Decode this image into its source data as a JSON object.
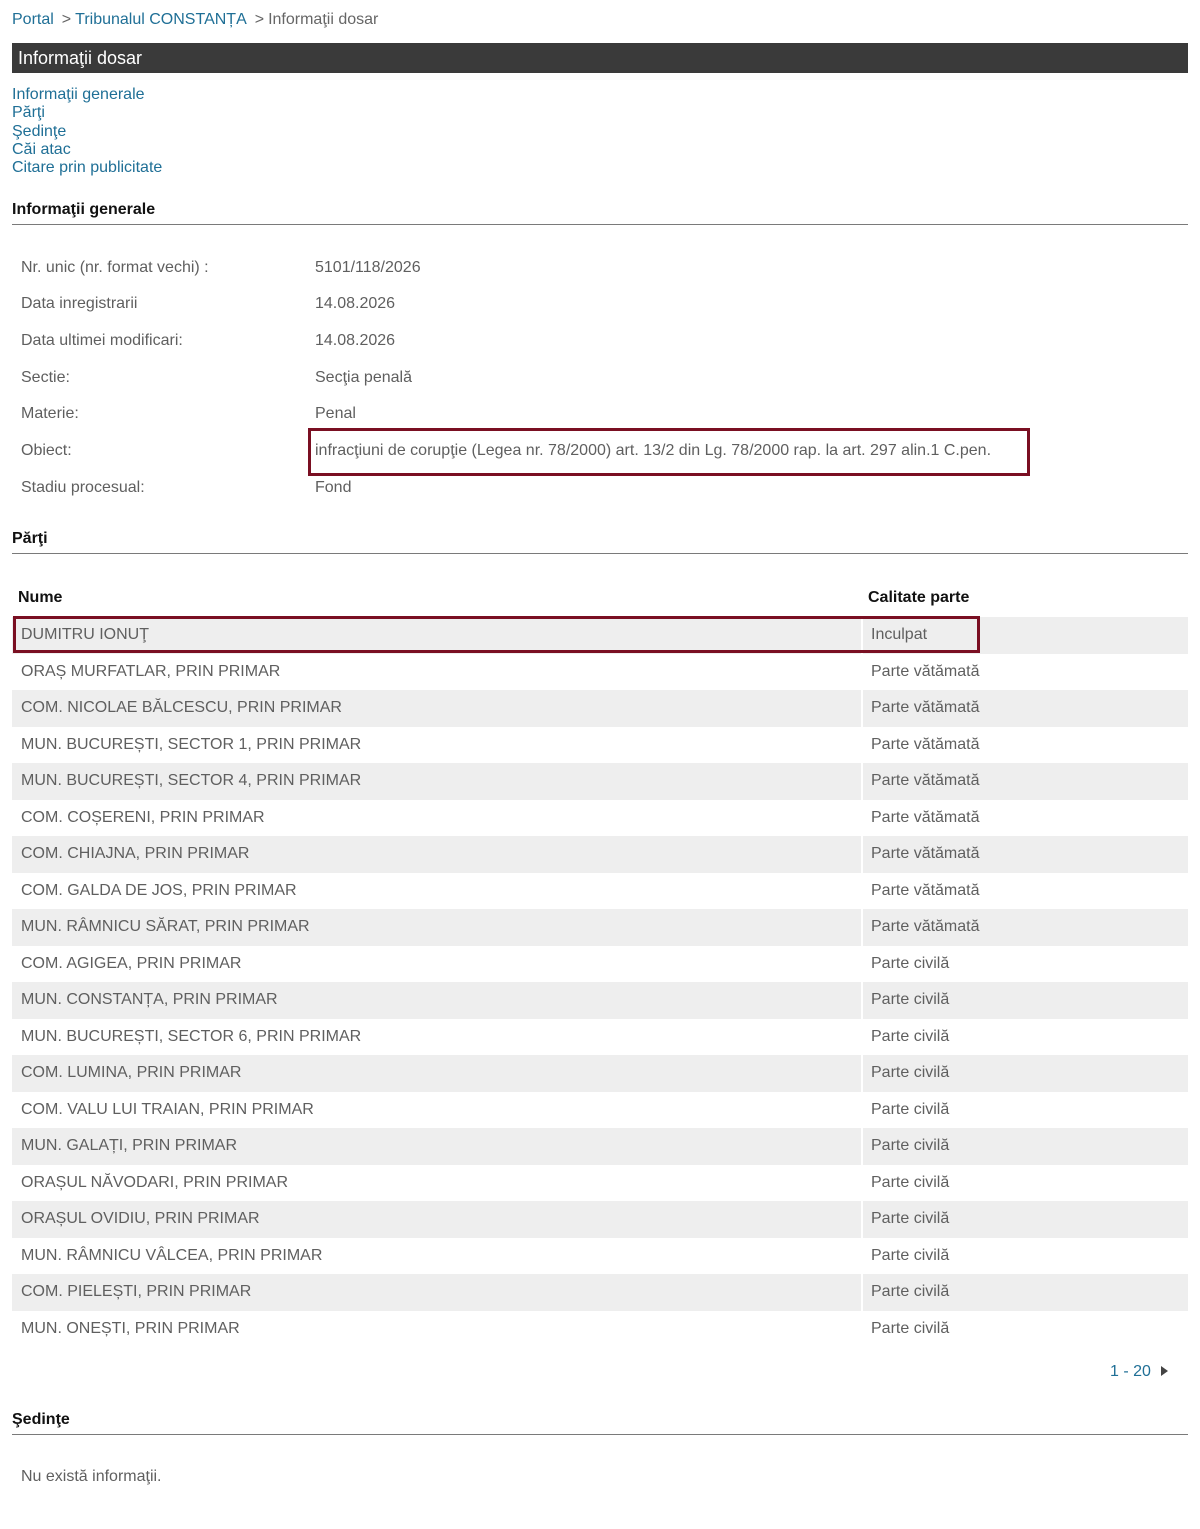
{
  "breadcrumb": {
    "portal": "Portal",
    "court": "Tribunalul CONSTANȚA",
    "current": "Informaţii dosar"
  },
  "header": {
    "title": "Informaţii dosar"
  },
  "toc": [
    "Informaţii generale",
    "Părţi",
    "Şedinţe",
    "Căi atac",
    "Citare prin publicitate"
  ],
  "general": {
    "title": "Informaţii generale",
    "rows": [
      {
        "label": "Nr. unic (nr. format vechi) :",
        "value": "5101/118/2026"
      },
      {
        "label": "Data inregistrarii",
        "value": "14.08.2026"
      },
      {
        "label": "Data ultimei modificari:",
        "value": "14.08.2026"
      },
      {
        "label": "Sectie:",
        "value": "Secţia penală"
      },
      {
        "label": "Materie:",
        "value": "Penal"
      },
      {
        "label": "Obiect:",
        "value": "infracţiuni de corupţie (Legea nr. 78/2000) art. 13/2 din Lg. 78/2000 rap. la art. 297 alin.1 C.pen."
      },
      {
        "label": "Stadiu procesual:",
        "value": "Fond"
      }
    ]
  },
  "parti": {
    "title": "Părţi",
    "col_name": "Nume",
    "col_role": "Calitate parte",
    "rows": [
      {
        "name": "DUMITRU IONUŢ",
        "role": "Inculpat"
      },
      {
        "name": "ORAȘ MURFATLAR, PRIN PRIMAR",
        "role": "Parte vătămată"
      },
      {
        "name": "COM. NICOLAE BĂLCESCU, PRIN PRIMAR",
        "role": "Parte vătămată"
      },
      {
        "name": "MUN. BUCUREȘTI, SECTOR 1, PRIN PRIMAR",
        "role": "Parte vătămată"
      },
      {
        "name": "MUN. BUCUREȘTI, SECTOR 4, PRIN PRIMAR",
        "role": "Parte vătămată"
      },
      {
        "name": "COM. COȘERENI, PRIN PRIMAR",
        "role": "Parte vătămată"
      },
      {
        "name": "COM. CHIAJNA, PRIN PRIMAR",
        "role": "Parte vătămată"
      },
      {
        "name": "COM. GALDA DE JOS, PRIN PRIMAR",
        "role": "Parte vătămată"
      },
      {
        "name": "MUN. RÂMNICU SĂRAT, PRIN PRIMAR",
        "role": "Parte vătămată"
      },
      {
        "name": "COM. AGIGEA, PRIN PRIMAR",
        "role": "Parte civilă"
      },
      {
        "name": "MUN. CONSTANȚA, PRIN PRIMAR",
        "role": "Parte civilă"
      },
      {
        "name": "MUN. BUCUREȘTI, SECTOR 6, PRIN PRIMAR",
        "role": "Parte civilă"
      },
      {
        "name": "COM. LUMINA, PRIN PRIMAR",
        "role": "Parte civilă"
      },
      {
        "name": "COM. VALU LUI TRAIAN, PRIN PRIMAR",
        "role": "Parte civilă"
      },
      {
        "name": "MUN. GALAȚI, PRIN PRIMAR",
        "role": "Parte civilă"
      },
      {
        "name": "ORAȘUL NĂVODARI, PRIN PRIMAR",
        "role": "Parte civilă"
      },
      {
        "name": "ORAȘUL OVIDIU, PRIN PRIMAR",
        "role": "Parte civilă"
      },
      {
        "name": "MUN. RÂMNICU VÂLCEA, PRIN PRIMAR",
        "role": "Parte civilă"
      },
      {
        "name": "COM. PIELEȘTI, PRIN PRIMAR",
        "role": "Parte civilă"
      },
      {
        "name": "MUN. ONEȘTI, PRIN PRIMAR",
        "role": "Parte civilă"
      }
    ],
    "pager": "1 - 20"
  },
  "sedinte": {
    "title": "Şedinţe",
    "empty": "Nu există informaţii."
  },
  "colors": {
    "link": "#1f6f96",
    "header_bar": "#3a3a3a",
    "highlight": "#7a0f22",
    "row_alt": "#eeeeee"
  }
}
